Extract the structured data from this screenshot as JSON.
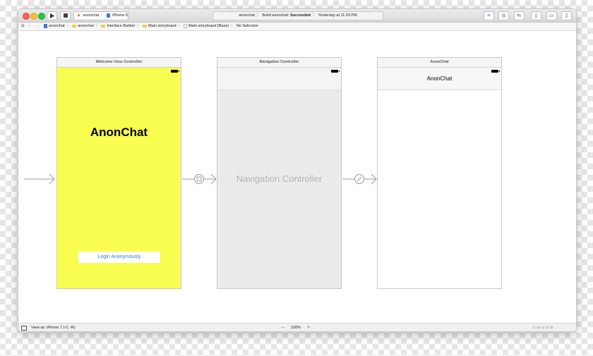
{
  "toolbar": {
    "scheme": "anonchat",
    "device": "iPhone 6",
    "status_prefix": "anonchat",
    "status_build": "Build anonchat:",
    "status_result": "Succeeded",
    "status_time": "Yesterday at 11:29 PM"
  },
  "breadcrumb": [
    {
      "label": "anonchat",
      "icon": "project-icon"
    },
    {
      "label": "anonchat",
      "icon": "folder-icon"
    },
    {
      "label": "Interface Builder",
      "icon": "folder-icon"
    },
    {
      "label": "Main.storyboard",
      "icon": "folder-icon"
    },
    {
      "label": "Main.storyboard (Base)",
      "icon": "storyboard-icon"
    },
    {
      "label": "No Selection",
      "icon": ""
    }
  ],
  "scenes": {
    "welcome": {
      "title": "Welcome View Controller",
      "heading": "AnonChat",
      "button": "Login Anonymously"
    },
    "navigation": {
      "title": "Navigation Controller",
      "label": "Navigation Controller"
    },
    "chat": {
      "title": "AnonChat",
      "nav_title": "AnonChat"
    }
  },
  "bottom": {
    "view_as": "View as: iPhone 7 (◦C ◦R)",
    "zoom_minus": "—",
    "zoom": "100%",
    "zoom_plus": "+"
  },
  "colors": {
    "welcome_bg": "#f8fd50",
    "nav_bg": "#ebebeb",
    "link": "#2d7fd9"
  }
}
